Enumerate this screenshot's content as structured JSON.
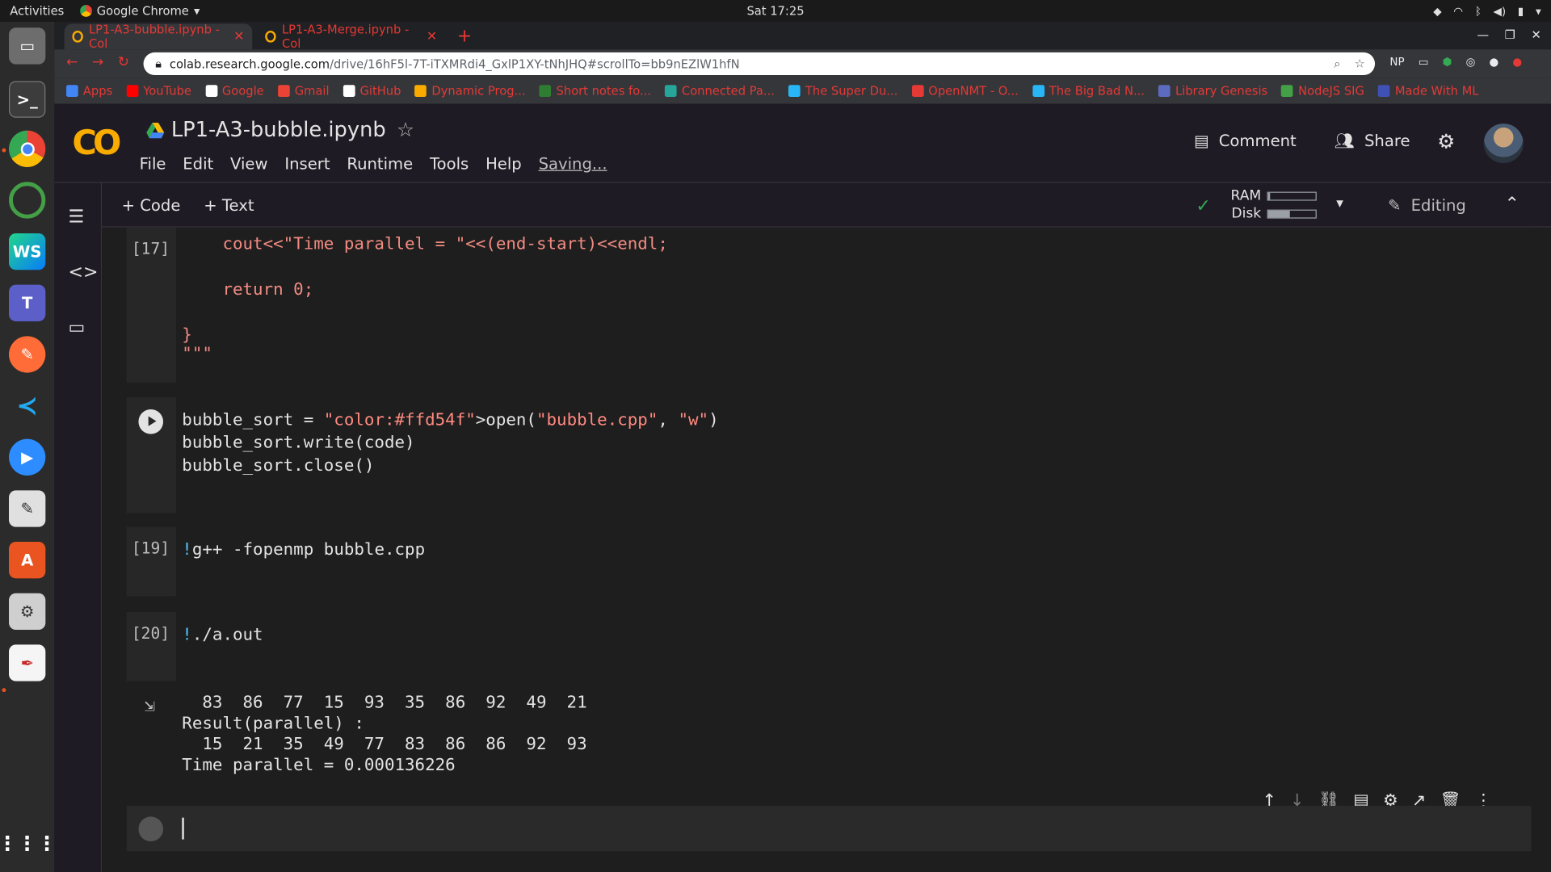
{
  "os": {
    "activities": "Activities",
    "app_name": "Google Chrome",
    "clock": "Sat 17:25"
  },
  "browser": {
    "tabs": [
      {
        "title": "LP1-A3-bubble.ipynb - Col"
      },
      {
        "title": "LP1-A3-Merge.ipynb - Col"
      }
    ],
    "url_host": "colab.research.google.com",
    "url_path": "/drive/16hF5l-7T-iTXMRdi4_GxlP1XY-tNhJHQ#scrollTo=bb9nEZlW1hfN",
    "extensions": [
      "NP"
    ],
    "bookmarks": [
      {
        "label": "Apps",
        "color": "#4285f4"
      },
      {
        "label": "YouTube",
        "color": "#ff0000"
      },
      {
        "label": "Google",
        "color": "#ffffff"
      },
      {
        "label": "Gmail",
        "color": "#ea4335"
      },
      {
        "label": "GitHub",
        "color": "#ffffff"
      },
      {
        "label": "Dynamic Prog...",
        "color": "#f9ab00"
      },
      {
        "label": "Short notes fo...",
        "color": "#2e7d32"
      },
      {
        "label": "Connected Pa...",
        "color": "#26a69a"
      },
      {
        "label": "The Super Du...",
        "color": "#29b6f6"
      },
      {
        "label": "OpenNMT - O...",
        "color": "#e53935"
      },
      {
        "label": "The Big Bad N...",
        "color": "#29b6f6"
      },
      {
        "label": "Library Genesis",
        "color": "#5c6bc0"
      },
      {
        "label": "NodeJS SIG",
        "color": "#43a047"
      },
      {
        "label": "Made With ML",
        "color": "#3f51b5"
      }
    ]
  },
  "colab": {
    "notebook_title": "LP1-A3-bubble.ipynb",
    "menu": [
      "File",
      "Edit",
      "View",
      "Insert",
      "Runtime",
      "Tools",
      "Help"
    ],
    "saving_status": "Saving...",
    "comment_label": "Comment",
    "share_label": "Share",
    "add_code_label": "+ Code",
    "add_text_label": "+ Text",
    "ram_label": "RAM",
    "disk_label": "Disk",
    "ram_usage": 0.05,
    "disk_usage": 0.45,
    "editing_label": "Editing"
  },
  "cells": [
    {
      "exec": "[17]",
      "lines": [
        "    cout<<\"Time parallel = \"<<(end-start)<<endl;",
        "",
        "    return 0;",
        "",
        "}",
        "\"\"\""
      ]
    },
    {
      "exec": "",
      "lines": [
        "bubble_sort = open(\"bubble.cpp\", \"w\")",
        "bubble_sort.write(code)",
        "bubble_sort.close()"
      ]
    },
    {
      "exec": "[19]",
      "lines": [
        "!g++ -fopenmp bubble.cpp"
      ]
    },
    {
      "exec": "[20]",
      "lines": [
        "!./a.out"
      ]
    }
  ],
  "output": {
    "lines": [
      "  83  86  77  15  93  35  86  92  49  21",
      "Result(parallel) :",
      "  15  21  35  49  77  83  86  86  92  93",
      "Time parallel = 0.000136226"
    ]
  }
}
